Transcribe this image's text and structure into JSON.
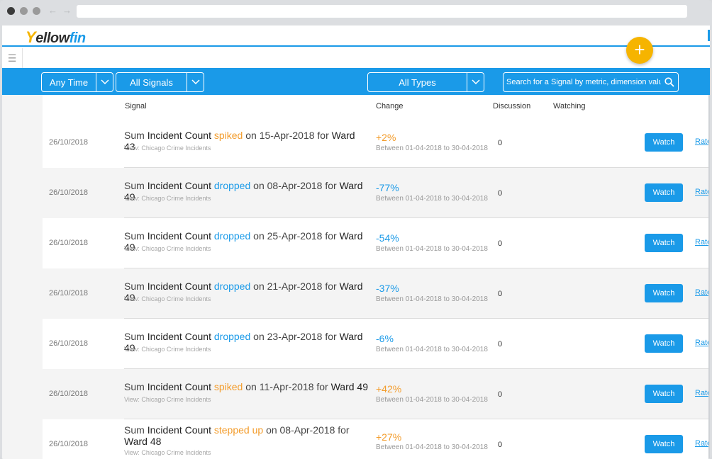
{
  "app": {
    "logo_y": "Y",
    "logo_ellow": "ellow",
    "logo_fin": "fin"
  },
  "fab_label": "+",
  "filters": {
    "time": "Any Time",
    "signals": "All Signals",
    "types": "All Types",
    "search_placeholder": "Search for a Signal by metric, dimension values"
  },
  "columns": {
    "signal": "Signal",
    "change": "Change",
    "discussion": "Discussion",
    "watching": "Watching"
  },
  "colors": {
    "accent": "#1a9ae8",
    "up": "#f39c2b",
    "fab": "#f6b400"
  },
  "rows": [
    {
      "date": "26/10/2018",
      "prefix": "Sum",
      "metric": "Incident Count",
      "verb": "spiked",
      "direction": "up",
      "on": "on 15-Apr-2018 for",
      "target": "Ward 43",
      "view": "View: Chicago Crime Incidents",
      "change": "+2%",
      "between": "Between 01-04-2018 to 30-04-2018",
      "discussion": "0",
      "watch": "Watch",
      "rate": "Rate"
    },
    {
      "date": "26/10/2018",
      "prefix": "Sum",
      "metric": "Incident Count",
      "verb": "dropped",
      "direction": "down",
      "on": "on 08-Apr-2018 for",
      "target": "Ward 49",
      "view": "View: Chicago Crime Incidents",
      "change": "-77%",
      "between": "Between 01-04-2018 to 30-04-2018",
      "discussion": "0",
      "watch": "Watch",
      "rate": "Rate"
    },
    {
      "date": "26/10/2018",
      "prefix": "Sum",
      "metric": "Incident Count",
      "verb": "dropped",
      "direction": "down",
      "on": "on 25-Apr-2018 for",
      "target": "Ward 49",
      "view": "View: Chicago Crime Incidents",
      "change": "-54%",
      "between": "Between 01-04-2018 to 30-04-2018",
      "discussion": "0",
      "watch": "Watch",
      "rate": "Rate"
    },
    {
      "date": "26/10/2018",
      "prefix": "Sum",
      "metric": "Incident Count",
      "verb": "dropped",
      "direction": "down",
      "on": "on 21-Apr-2018 for",
      "target": "Ward 49",
      "view": "View: Chicago Crime Incidents",
      "change": "-37%",
      "between": "Between 01-04-2018 to 30-04-2018",
      "discussion": "0",
      "watch": "Watch",
      "rate": "Rate"
    },
    {
      "date": "26/10/2018",
      "prefix": "Sum",
      "metric": "Incident Count",
      "verb": "dropped",
      "direction": "down",
      "on": "on 23-Apr-2018 for",
      "target": "Ward 49",
      "view": "View: Chicago Crime Incidents",
      "change": "-6%",
      "between": "Between 01-04-2018 to 30-04-2018",
      "discussion": "0",
      "watch": "Watch",
      "rate": "Rate"
    },
    {
      "date": "26/10/2018",
      "prefix": "Sum",
      "metric": "Incident Count",
      "verb": "spiked",
      "direction": "up",
      "on": "on 11-Apr-2018 for",
      "target": "Ward 49",
      "view": "View: Chicago Crime Incidents",
      "change": "+42%",
      "between": "Between 01-04-2018 to 30-04-2018",
      "discussion": "0",
      "watch": "Watch",
      "rate": "Rate"
    },
    {
      "date": "26/10/2018",
      "prefix": "Sum",
      "metric": "Incident Count",
      "verb": "stepped up",
      "direction": "up",
      "on": "on 08-Apr-2018 for",
      "target": "Ward 48",
      "view": "View: Chicago Crime Incidents",
      "change": "+27%",
      "between": "Between 01-04-2018 to 30-04-2018",
      "discussion": "0",
      "watch": "Watch",
      "rate": "Rate"
    }
  ]
}
